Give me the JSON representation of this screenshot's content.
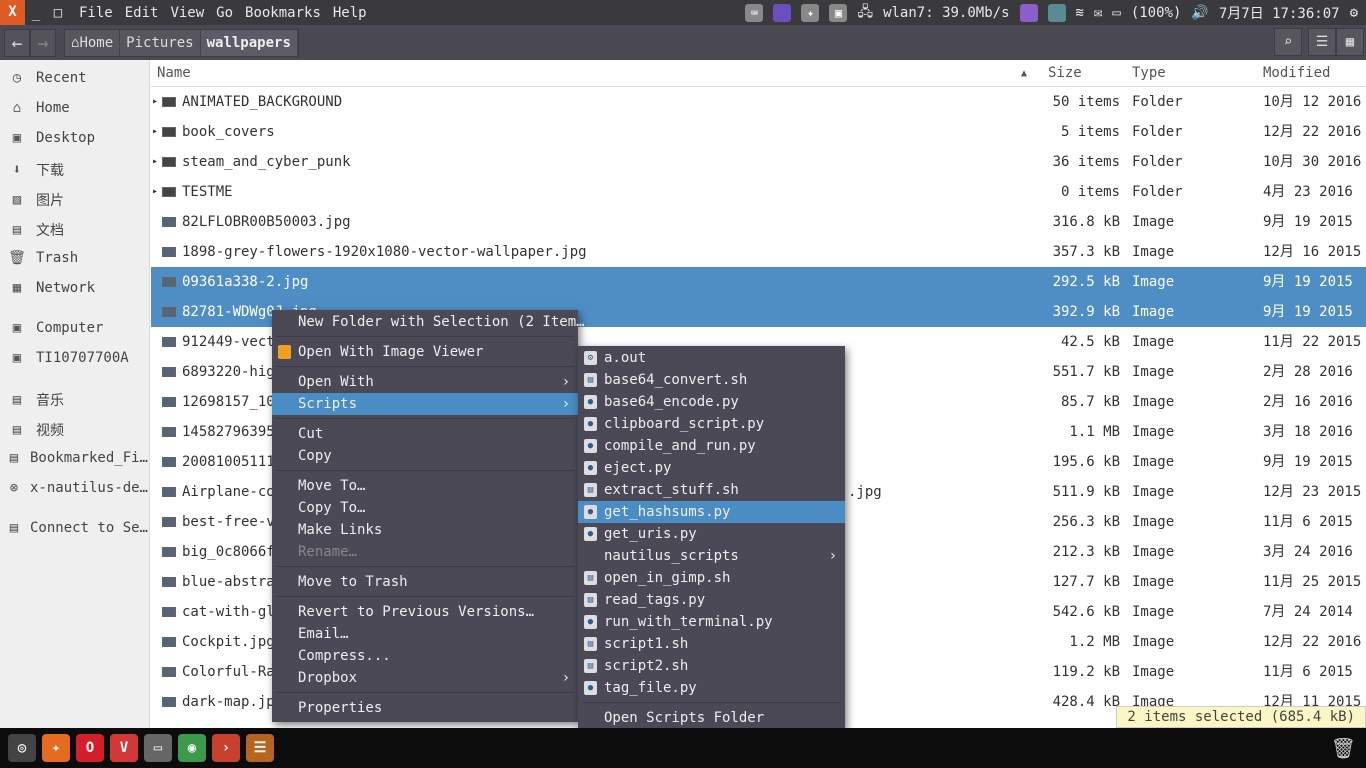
{
  "window": {
    "close": "X",
    "minimize": "_",
    "maximize": "□"
  },
  "menubar": [
    "File",
    "Edit",
    "View",
    "Go",
    "Bookmarks",
    "Help"
  ],
  "tray": {
    "network": "wlan7: 39.0Mb/s",
    "battery": "(100%)",
    "clock": "7月7日 17:36:07"
  },
  "toolbar": {
    "back": "←",
    "forward": "→",
    "breadcrumbs": [
      "Home",
      "Pictures",
      "wallpapers"
    ],
    "search": "⌕",
    "list_view": "☰",
    "grid_view": "▦"
  },
  "sidebar": [
    {
      "label": "Recent",
      "icon": "◷"
    },
    {
      "label": "Home",
      "icon": "⌂"
    },
    {
      "label": "Desktop",
      "icon": "▣"
    },
    {
      "label": "下载",
      "icon": "⬇"
    },
    {
      "label": "图片",
      "icon": "▨"
    },
    {
      "label": "文档",
      "icon": "▤"
    },
    {
      "label": "Trash",
      "icon": "🗑"
    },
    {
      "label": "Network",
      "icon": "▦"
    },
    {
      "label": "Computer",
      "icon": "▣"
    },
    {
      "label": "TI10707700A",
      "icon": "▣"
    },
    {
      "label": "音乐",
      "icon": "▤"
    },
    {
      "label": "视频",
      "icon": "▤"
    },
    {
      "label": "Bookmarked_Fi…",
      "icon": "▤"
    },
    {
      "label": "x-nautilus-de…",
      "icon": "⊗"
    },
    {
      "label": "Connect to Se…",
      "icon": "▤"
    }
  ],
  "columns": {
    "name": "Name",
    "size": "Size",
    "type": "Type",
    "modified": "Modified"
  },
  "files": [
    {
      "name": "ANIMATED_BACKGROUND",
      "size": "50 items",
      "type": "Folder",
      "modified": "10月 12 2016",
      "folder": true
    },
    {
      "name": "book_covers",
      "size": "5 items",
      "type": "Folder",
      "modified": "12月 22 2016",
      "folder": true
    },
    {
      "name": "steam_and_cyber_punk",
      "size": "36 items",
      "type": "Folder",
      "modified": "10月 30 2016",
      "folder": true
    },
    {
      "name": "TESTME",
      "size": "0 items",
      "type": "Folder",
      "modified": "4月 23 2016",
      "folder": true
    },
    {
      "name": "82LFLOBR00B50003.jpg",
      "size": "316.8 kB",
      "type": "Image",
      "modified": "9月 19 2015"
    },
    {
      "name": "1898-grey-flowers-1920x1080-vector-wallpaper.jpg",
      "size": "357.3 kB",
      "type": "Image",
      "modified": "12月 16 2015"
    },
    {
      "name": "09361a338-2.jpg",
      "size": "292.5 kB",
      "type": "Image",
      "modified": "9月 19 2015",
      "selected": true
    },
    {
      "name": "82781-WDWg0J.jpg",
      "size": "392.9 kB",
      "type": "Image",
      "modified": "9月 19 2015",
      "selected": true
    },
    {
      "name": "912449-vecto",
      "size": "42.5 kB",
      "type": "Image",
      "modified": "11月 22 2015"
    },
    {
      "name": "6893220-high",
      "size": "551.7 kB",
      "type": "Image",
      "modified": "2月 28 2016"
    },
    {
      "name": "12698157_102",
      "size": "85.7 kB",
      "type": "Image",
      "modified": "2月 16 2016"
    },
    {
      "name": "14582796395",
      "size": "1.1 MB",
      "type": "Image",
      "modified": "3月 18 2016"
    },
    {
      "name": "200810051114",
      "size": "195.6 kB",
      "type": "Image",
      "modified": "9月 19 2015"
    },
    {
      "name": "Airplane-coc",
      "tail": ".jpg",
      "size": "511.9 kB",
      "type": "Image",
      "modified": "12月 23 2015"
    },
    {
      "name": "best-free-ve",
      "size": "256.3 kB",
      "type": "Image",
      "modified": "11月 6 2015"
    },
    {
      "name": "big_0c8066f9",
      "size": "212.3 kB",
      "type": "Image",
      "modified": "3月 24 2016"
    },
    {
      "name": "blue-abstrac",
      "size": "127.7 kB",
      "type": "Image",
      "modified": "11月 25 2015"
    },
    {
      "name": "cat-with-gla",
      "size": "542.6 kB",
      "type": "Image",
      "modified": "7月 24 2014"
    },
    {
      "name": "Cockpit.jpg",
      "size": "1.2 MB",
      "type": "Image",
      "modified": "12月 22 2016"
    },
    {
      "name": "Colorful-Ra",
      "size": "119.2 kB",
      "type": "Image",
      "modified": "11月 6 2015"
    },
    {
      "name": "dark-map.jpg",
      "size": "428.4 kB",
      "type": "Image",
      "modified": "12月 11 2015"
    }
  ],
  "context_menu": [
    {
      "label": "New Folder with Selection (2 Item…"
    },
    {
      "sep": true
    },
    {
      "label": "Open With Image Viewer",
      "icon": true
    },
    {
      "sep": true
    },
    {
      "label": "Open With",
      "submenu": true
    },
    {
      "label": "Scripts",
      "submenu": true,
      "highlighted": true
    },
    {
      "sep": true
    },
    {
      "label": "Cut"
    },
    {
      "label": "Copy"
    },
    {
      "sep": true
    },
    {
      "label": "Move To…"
    },
    {
      "label": "Copy To…"
    },
    {
      "label": "Make Links"
    },
    {
      "label": "Rename…",
      "disabled": true
    },
    {
      "sep": true
    },
    {
      "label": "Move to Trash"
    },
    {
      "sep": true
    },
    {
      "label": "Revert to Previous Versions…"
    },
    {
      "label": "Email…"
    },
    {
      "label": "Compress..."
    },
    {
      "label": "Dropbox",
      "submenu": true
    },
    {
      "sep": true
    },
    {
      "label": "Properties"
    }
  ],
  "scripts_menu": [
    {
      "label": "a.out",
      "icon": "⚙"
    },
    {
      "label": "base64_convert.sh",
      "icon": "▤"
    },
    {
      "label": "base64_encode.py",
      "icon": "py"
    },
    {
      "label": "clipboard_script.py",
      "icon": "py"
    },
    {
      "label": "compile_and_run.py",
      "icon": "py"
    },
    {
      "label": "eject.py",
      "icon": "py"
    },
    {
      "label": "extract_stuff.sh",
      "icon": "▤"
    },
    {
      "label": "get_hashsums.py",
      "icon": "py",
      "highlighted": true
    },
    {
      "label": "get_uris.py",
      "icon": "py"
    },
    {
      "label": "nautilus_scripts",
      "submenu": true
    },
    {
      "label": "open_in_gimp.sh",
      "icon": "▤"
    },
    {
      "label": "read_tags.py",
      "icon": "▤"
    },
    {
      "label": "run_with_terminal.py",
      "icon": "py"
    },
    {
      "label": "script1.sh",
      "icon": "▤"
    },
    {
      "label": "script2.sh",
      "icon": "▤"
    },
    {
      "label": "tag_file.py",
      "icon": "py"
    },
    {
      "sep": true
    },
    {
      "label": "Open Scripts Folder"
    }
  ],
  "status": "2 items selected (685.4 kB)",
  "taskbar": [
    {
      "name": "ubuntu",
      "color": "#444",
      "g": "◎"
    },
    {
      "name": "firefox",
      "color": "#e66a1f",
      "g": "✦"
    },
    {
      "name": "opera",
      "color": "#d21f2b",
      "g": "O"
    },
    {
      "name": "vivaldi",
      "color": "#d23838",
      "g": "V"
    },
    {
      "name": "terminal",
      "color": "#666",
      "g": "▭"
    },
    {
      "name": "chrome",
      "color": "#3d9a4d",
      "g": "◉"
    },
    {
      "name": "terminal-app",
      "color": "#c8412f",
      "g": "›"
    },
    {
      "name": "files",
      "color": "#b5651d",
      "g": "☰"
    }
  ],
  "trash_icon": "🗑"
}
